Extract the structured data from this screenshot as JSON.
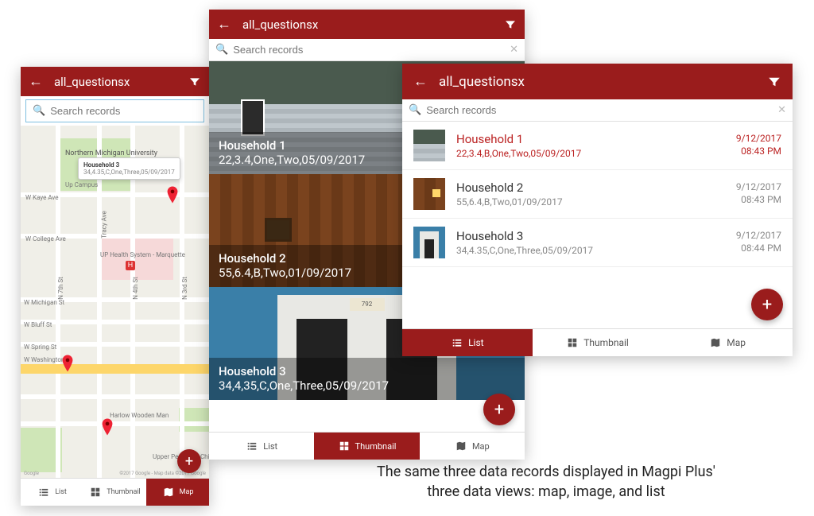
{
  "colors": {
    "brand": "#9a1c1c"
  },
  "header": {
    "title": "all_questionsx"
  },
  "search": {
    "placeholder": "Search records"
  },
  "tabs": {
    "list": "List",
    "thumbnail": "Thumbnail",
    "map": "Map"
  },
  "fab": {
    "label": "+"
  },
  "caption": {
    "line1": "The same three data records displayed in Magpi Plus'",
    "line2": "three data views: map, image, and list"
  },
  "map": {
    "callout": {
      "title": "Household 3",
      "sub": "34,4.35,C,One,Three,05/09/2017"
    },
    "poi": {
      "nmu": "Northern Michigan University",
      "hospital": "UP Health System - Marquette",
      "museum": "Upper Peninsula Children's Museum",
      "woodenman": "Harlow Wooden Man",
      "upcampus": "Up Campus"
    },
    "roads": {
      "michigan": "W Michigan St",
      "bluff": "W Bluff St",
      "spring": "W Spring St",
      "washington": "W Washington St",
      "college": "W College Ave",
      "kaye": "W Kaye Ave",
      "n3rd": "N 3rd St",
      "n4th": "N 4th St",
      "n7th": "N 7th St",
      "tracyr": "Tracy Ave"
    },
    "attrib_left": "Google",
    "attrib_right": "©2017 Google - Map data ©2017 Google"
  },
  "records": [
    {
      "title": "Household 1",
      "sub_thumb": "22,3.4,One,Two,05/09/2017",
      "sub_list": "22,3.4,B,One,Two,05/09/2017",
      "date": "9/12/2017",
      "time": "08:43 PM"
    },
    {
      "title": "Household 2",
      "sub_thumb": "55,6.4,B,Two,01/09/2017",
      "sub_list": "55,6.4,B,Two,01/09/2017",
      "date": "9/12/2017",
      "time": "08:43 PM"
    },
    {
      "title": "Household 3",
      "sub_thumb": "34,4,35,C,One,Three,05/09/2017",
      "sub_list": "34,4.35,C,One,Three,05/09/2017",
      "date": "9/12/2017",
      "time": "08:44 PM"
    }
  ],
  "plaque": "792"
}
